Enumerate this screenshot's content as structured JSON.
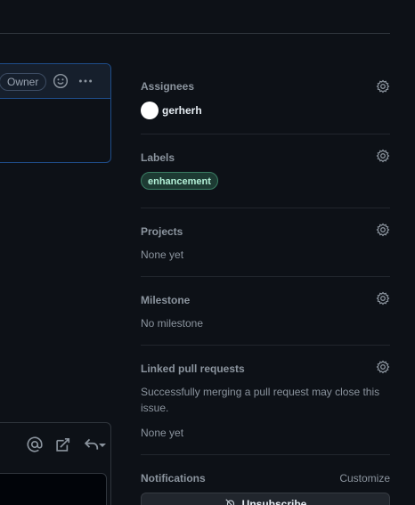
{
  "comment": {
    "owner_badge": "Owner",
    "icons": {
      "reaction": "smiley-icon",
      "more": "kebab-horizontal-icon"
    }
  },
  "reply_toolbar": {
    "icons": [
      "mention-icon",
      "cross-reference-icon",
      "reply-icon",
      "chevron-down-icon"
    ]
  },
  "sidebar": {
    "assignees": {
      "title": "Assignees",
      "items": [
        {
          "name": "gerherh"
        }
      ]
    },
    "labels": {
      "title": "Labels",
      "items": [
        {
          "name": "enhancement",
          "color": "#1d3b33",
          "text_color": "#b2f0d7"
        }
      ]
    },
    "projects": {
      "title": "Projects",
      "value": "None yet"
    },
    "milestone": {
      "title": "Milestone",
      "value": "No milestone"
    },
    "linked_prs": {
      "title": "Linked pull requests",
      "description": "Successfully merging a pull request may close this issue.",
      "value": "None yet"
    },
    "notifications": {
      "title": "Notifications",
      "customize_label": "Customize",
      "button_label": "Unsubscribe"
    }
  },
  "colors": {
    "background": "#0d1117",
    "border": "#30363d",
    "accent_border": "#1f4d8a",
    "muted_text": "#8b949e"
  }
}
